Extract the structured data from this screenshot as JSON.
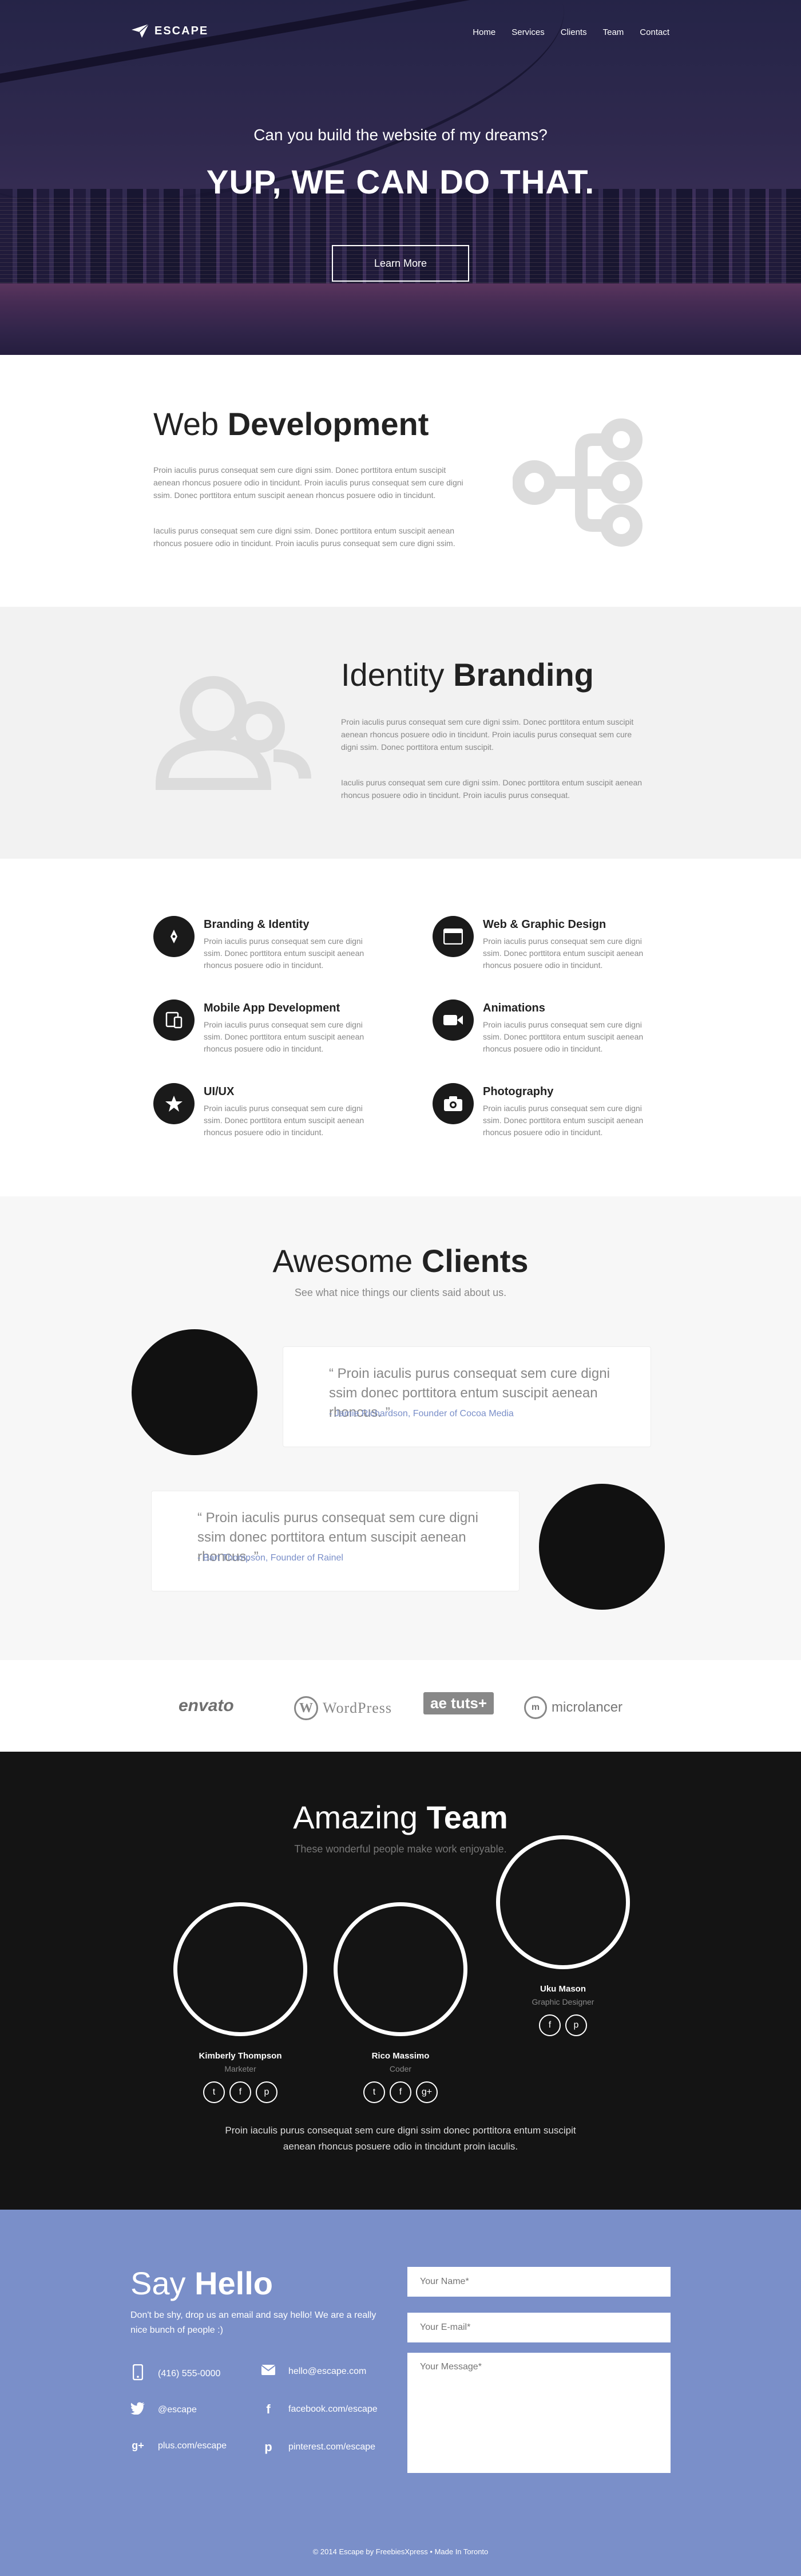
{
  "header": {
    "logo_text": "ESCAPE",
    "nav": [
      "Home",
      "Services",
      "Clients",
      "Team",
      "Contact"
    ]
  },
  "hero": {
    "subtitle": "Can you build the website of my dreams?",
    "title": "YUP, WE CAN DO THAT.",
    "button": "Learn More"
  },
  "webdev": {
    "title_light": "Web ",
    "title_bold": "Development",
    "p1": "Proin iaculis purus consequat sem cure digni ssim. Donec porttitora entum suscipit aenean rhoncus posuere odio in tincidunt. Proin iaculis purus consequat sem cure digni ssim. Donec porttitora entum suscipit aenean rhoncus posuere odio in tincidunt.",
    "p2": "Iaculis purus consequat sem cure digni ssim. Donec porttitora entum suscipit aenean rhoncus posuere odio in tincidunt. Proin iaculis purus consequat sem cure digni ssim."
  },
  "branding": {
    "title_light": "Identity ",
    "title_bold": "Branding",
    "p1": "Proin iaculis purus consequat sem cure digni ssim. Donec porttitora entum suscipit aenean rhoncus posuere odio in tincidunt. Proin iaculis purus consequat sem cure digni ssim. Donec porttitora entum suscipit.",
    "p2": "Iaculis purus consequat sem cure digni ssim. Donec porttitora entum suscipit aenean rhoncus posuere odio in tincidunt. Proin iaculis purus consequat."
  },
  "services": [
    {
      "title": "Branding & Identity",
      "icon": "pen-icon",
      "text": "Proin iaculis purus consequat sem cure digni ssim. Donec porttitora entum suscipit aenean rhoncus posuere odio in tincidunt."
    },
    {
      "title": "Web & Graphic Design",
      "icon": "browser-icon",
      "text": "Proin iaculis purus consequat sem cure digni ssim. Donec porttitora entum suscipit aenean rhoncus posuere odio in tincidunt."
    },
    {
      "title": "Mobile App Development",
      "icon": "devices-icon",
      "text": "Proin iaculis purus consequat sem cure digni ssim. Donec porttitora entum suscipit aenean rhoncus posuere odio in tincidunt."
    },
    {
      "title": "Animations",
      "icon": "video-icon",
      "text": "Proin iaculis purus consequat sem cure digni ssim. Donec porttitora entum suscipit aenean rhoncus posuere odio in tincidunt."
    },
    {
      "title": "UI/UX",
      "icon": "star-icon",
      "text": "Proin iaculis purus consequat sem cure digni ssim. Donec porttitora entum suscipit aenean rhoncus posuere odio in tincidunt."
    },
    {
      "title": "Photography",
      "icon": "camera-icon",
      "text": "Proin iaculis purus consequat sem cure digni ssim. Donec porttitora entum suscipit aenean rhoncus posuere odio in tincidunt."
    }
  ],
  "clients": {
    "title_light": "Awesome ",
    "title_bold": "Clients",
    "subtitle": "See what nice things our clients said about us.",
    "testimonials": [
      {
        "quote": "“ Proin iaculis purus consequat sem cure  digni ssim donec porttitora entum suscipit aenean rhoncus. ”",
        "author": "- Jamie Richardson, Founder of Cocoa Media"
      },
      {
        "quote": "“ Proin iaculis purus consequat sem cure  digni ssim donec porttitora entum suscipit aenean rhoncus. ”",
        "author": "- Bart Thompson, Founder of Rainel"
      }
    ]
  },
  "partners": [
    "envato",
    "WordPress",
    "tuts+",
    "microlancer"
  ],
  "team": {
    "title_light": "Amazing ",
    "title_bold": "Team",
    "subtitle": "These wonderful people make work enjoyable.",
    "members": [
      {
        "name": "Kimberly Thompson",
        "role": "Marketer",
        "socials": [
          "twitter-icon",
          "facebook-icon",
          "pinterest-icon"
        ]
      },
      {
        "name": "Rico Massimo",
        "role": "Coder",
        "socials": [
          "twitter-icon",
          "facebook-icon",
          "google-plus-icon"
        ]
      },
      {
        "name": "Uku Mason",
        "role": "Graphic Designer",
        "socials": [
          "facebook-icon",
          "pinterest-icon"
        ]
      }
    ],
    "footer_text": "Proin iaculis purus consequat sem cure  digni ssim donec porttitora entum suscipit aenean rhoncus posuere odio in tincidunt proin iaculis."
  },
  "contact": {
    "title_light": "Say ",
    "title_bold": "Hello",
    "intro": "Don't be shy, drop us an email and say hello! We are a really nice bunch of people :)",
    "phone": "(416) 555-0000",
    "email": "hello@escape.com",
    "twitter": "@escape",
    "facebook": "facebook.com/escape",
    "gplus": "plus.com/escape",
    "pinterest": "pinterest.com/escape",
    "name_placeholder": "Your Name*",
    "email_placeholder": "Your E-mail*",
    "message_placeholder": "Your Message*"
  },
  "footer": {
    "text": "© 2014 Escape by FreebiesXpress • Made In Toronto"
  },
  "colors": {
    "accent": "#7a8fc9",
    "dark": "#141414",
    "gray_bg": "#f2f2f2"
  }
}
